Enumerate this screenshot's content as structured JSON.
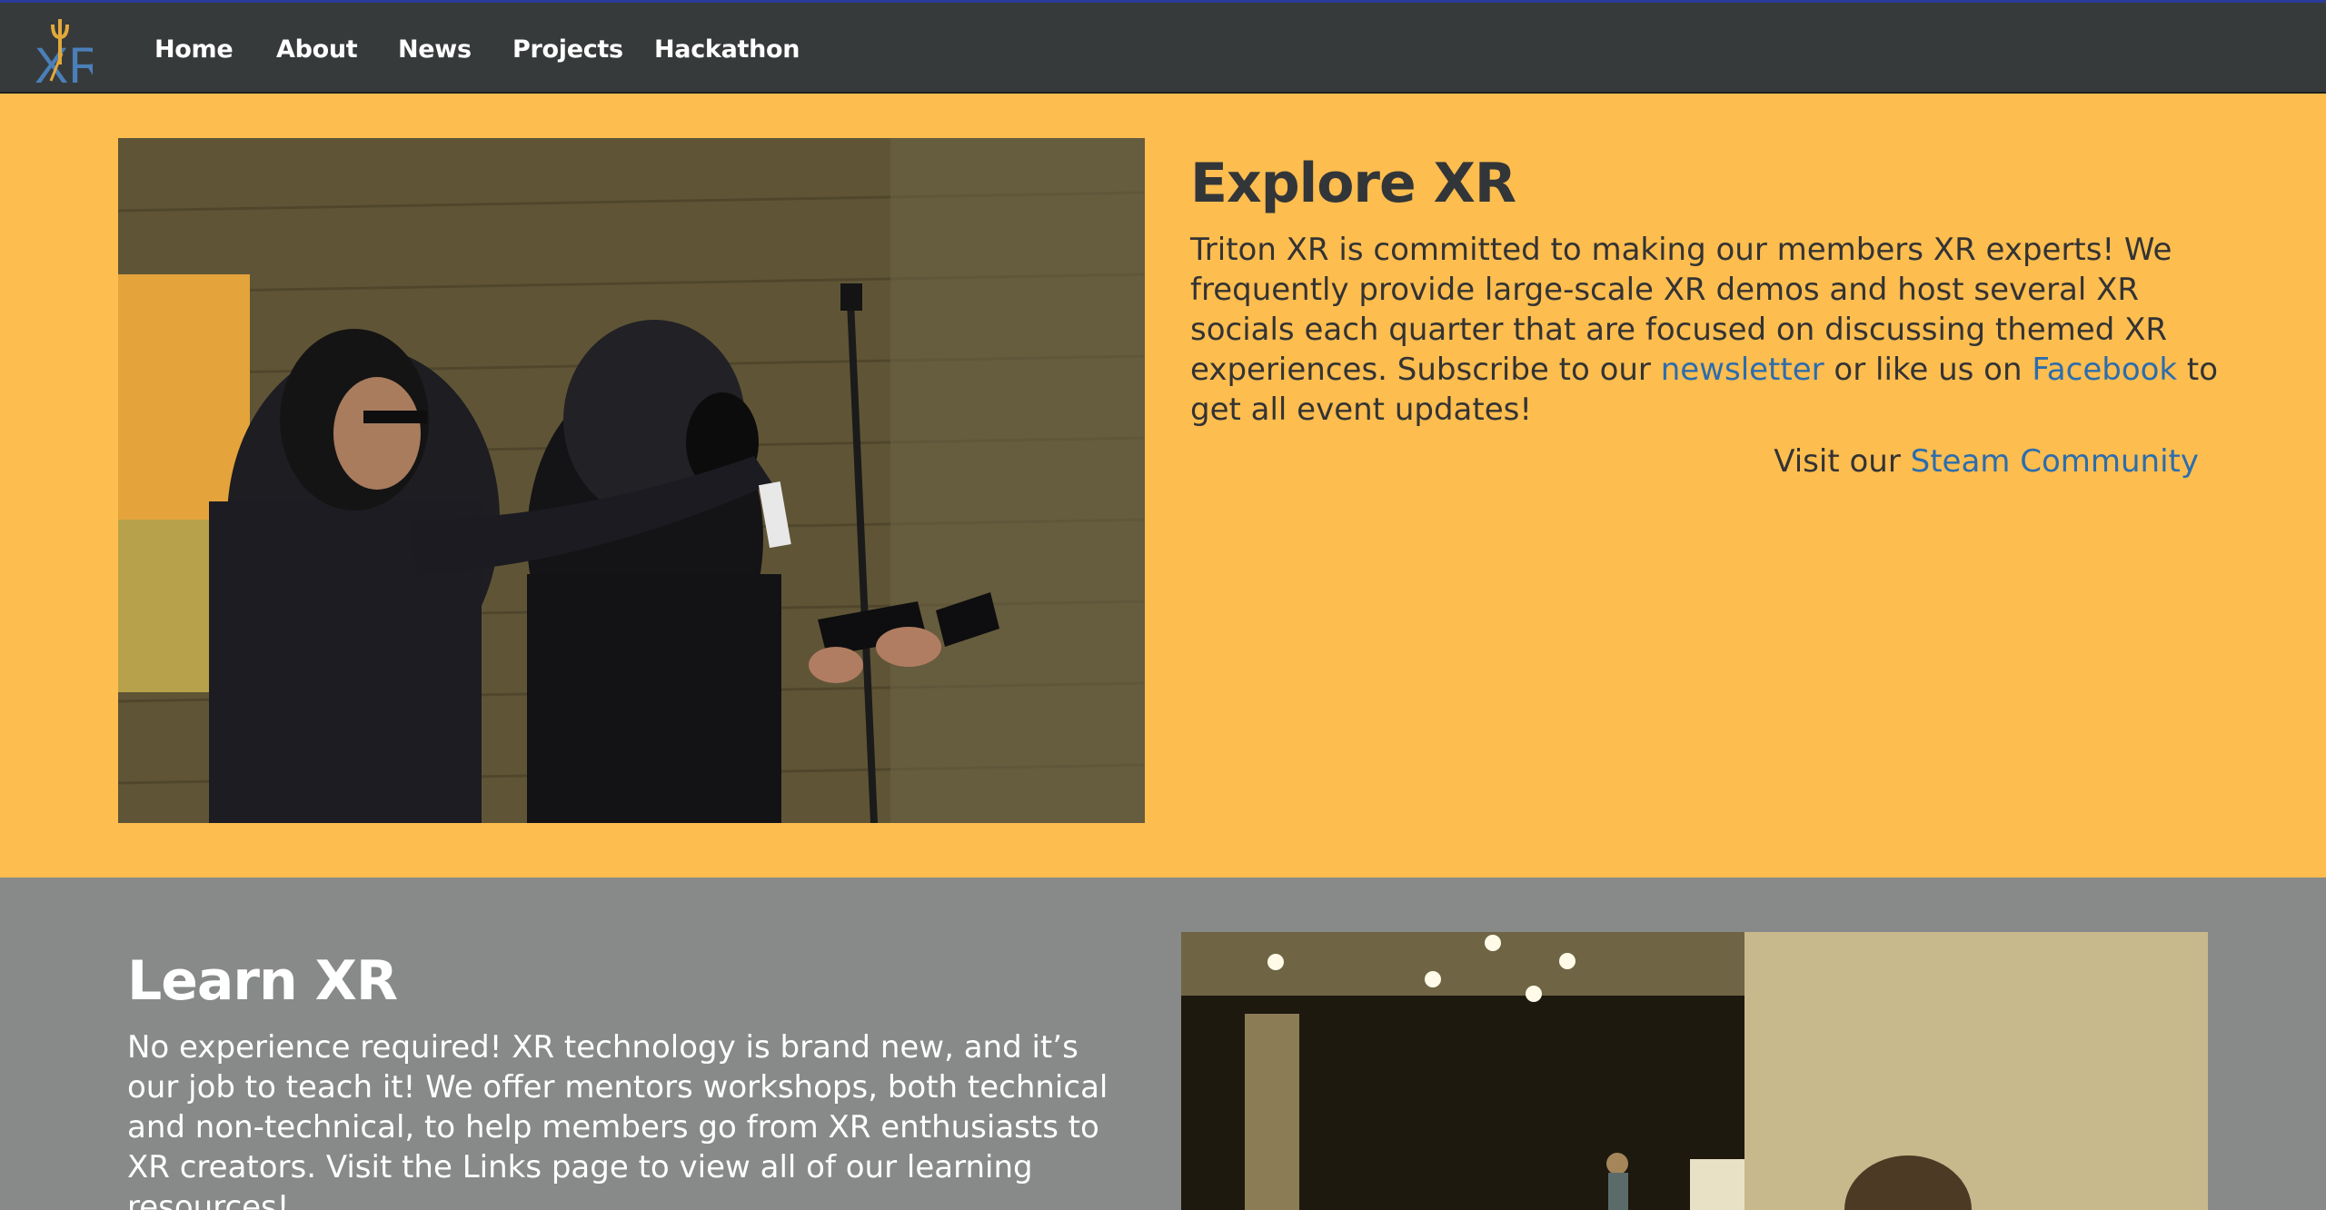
{
  "nav": {
    "logo_text": "XR",
    "items": [
      "Home",
      "About",
      "News",
      "Projects",
      "Hackathon"
    ]
  },
  "explore": {
    "title": "Explore XR",
    "body_before": "Triton XR is committed to making our members XR experts! We frequently provide large-scale XR demos and host several XR socials each quarter that are focused on discussing themed XR experiences. Subscribe to our ",
    "newsletter_link": "newsletter",
    "body_middle": " or like us on ",
    "facebook_link": "Facebook",
    "body_after": " to get all event updates!",
    "steam_prefix": "Visit our ",
    "steam_link": "Steam Community"
  },
  "learn": {
    "title": "Learn XR",
    "body": "No experience required! XR technology is brand new, and it’s our job to teach it! We offer mentors workshops, both technical and non-technical, to help members go from XR enthusiasts to XR creators. Visit the Links page to view all of our learning resources!"
  },
  "colors": {
    "navbar": "#373a3b",
    "explore_bg": "#fdbd4f",
    "learn_bg": "#878a89",
    "link": "#2c6dad",
    "logo_blue": "#4a7fb8",
    "logo_gold": "#e2a93a"
  }
}
